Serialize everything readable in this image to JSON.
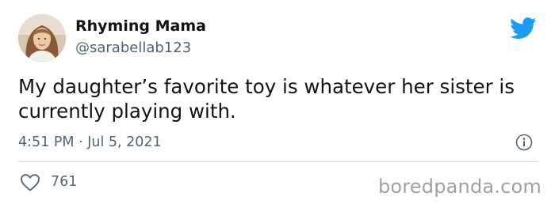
{
  "tweet": {
    "author": {
      "display_name": "Rhyming Mama",
      "handle": "@sarabellab123",
      "avatar_icon": "avatar"
    },
    "text": "My daughter’s favorite toy is whatever her sister is currently playing with.",
    "timestamp": "4:51 PM · Jul 5, 2021",
    "likes": "761"
  },
  "icons": {
    "brand": "twitter-bird-icon",
    "info": "info-icon",
    "like": "heart-icon"
  },
  "watermark": "boredpanda.com",
  "colors": {
    "twitter_blue": "#1d9bf0",
    "secondary_text": "#536471",
    "primary_text": "#0f1419",
    "divider": "#cfd9de"
  }
}
